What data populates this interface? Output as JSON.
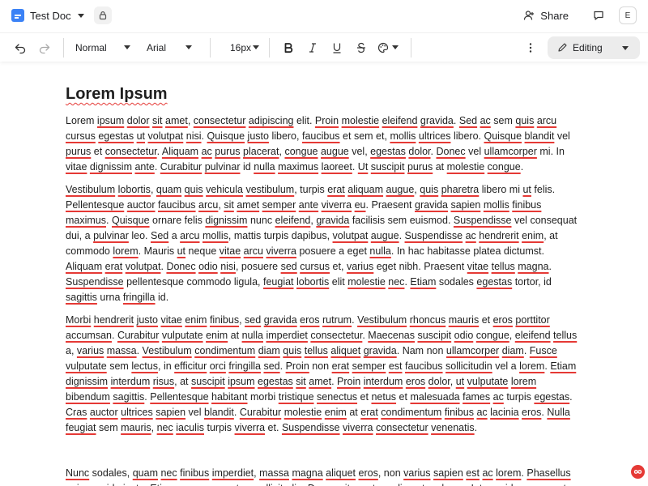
{
  "titlebar": {
    "doc_title": "Test Doc",
    "share_label": "Share",
    "avatar_initial": "E"
  },
  "toolbar": {
    "style_value": "Normal",
    "font_value": "Arial",
    "size_value": "16px",
    "mode_label": "Editing"
  },
  "document": {
    "heading": "Lorem Ipsum",
    "paragraphs": [
      "Lorem ipsum dolor sit amet, consectetur adipiscing elit. Proin molestie eleifend gravida. Sed ac sem quis arcu cursus egestas ut volutpat nisi. Quisque justo libero, faucibus et sem et, mollis ultrices libero. Quisque blandit vel purus et consectetur. Aliquam ac purus placerat, congue augue vel, egestas dolor. Donec vel ullamcorper mi. In vitae dignissim ante. Curabitur pulvinar id nulla maximus laoreet. Ut suscipit purus at molestie congue.",
      "Vestibulum lobortis, quam quis vehicula vestibulum, turpis erat aliquam augue, quis pharetra libero mi ut felis. Pellentesque auctor faucibus arcu, sit amet semper ante viverra eu. Praesent gravida sapien mollis finibus maximus. Quisque ornare felis dignissim nunc eleifend, gravida facilisis sem euismod. Suspendisse vel consequat dui, a pulvinar leo. Sed a arcu mollis, mattis turpis dapibus, volutpat augue. Suspendisse ac hendrerit enim, at commodo lorem. Mauris ut neque vitae arcu viverra posuere a eget nulla. In hac habitasse platea dictumst. Aliquam erat volutpat. Donec odio nisi, posuere sed cursus et, varius eget nibh. Praesent vitae tellus magna. Suspendisse pellentesque commodo ligula, feugiat lobortis elit molestie nec. Etiam sodales egestas tortor, id sagittis urna fringilla id.",
      "Morbi hendrerit justo vitae enim finibus, sed gravida eros rutrum. Vestibulum rhoncus mauris et eros porttitor accumsan. Curabitur vulputate enim at nulla imperdiet consectetur. Maecenas suscipit odio congue, eleifend tellus a, varius massa. Vestibulum condimentum diam quis tellus aliquet gravida. Nam non ullamcorper diam. Fusce vulputate sem lectus, in efficitur orci fringilla sed. Proin non erat semper est faucibus sollicitudin vel a lorem. Etiam dignissim interdum risus, at suscipit ipsum egestas sit amet. Proin interdum eros dolor, ut vulputate lorem bibendum sagittis. Pellentesque habitant morbi tristique senectus et netus et malesuada fames ac turpis egestas. Cras auctor ultrices sapien vel blandit. Curabitur molestie enim at erat condimentum finibus ac lacinia eros. Nulla feugiat sem mauris, nec iaculis turpis viverra et. Suspendisse viverra consectetur venenatis.",
      "Nunc sodales, quam nec finibus imperdiet, massa magna aliquet eros, non varius sapien est ac lorem. Phasellus quis gravida justo. Etiam cursus eu est ac sollicitudin. Donec sit amet condimentum lacus. Integer id cursus erat."
    ],
    "spellcheck_words": [
      "consectetur",
      "adipiscing",
      "Proin",
      "molestie",
      "eleifend",
      "gravida",
      "Sed",
      "quis",
      "arcu",
      "cursus",
      "egestas",
      "ut",
      "volutpat",
      "nisi",
      "Quisque",
      "justo",
      "faucibus",
      "mollis",
      "ultrices",
      "blandit",
      "purus",
      "Aliquam",
      "ac",
      "placerat",
      "congue",
      "augue",
      "dolor",
      "Donec",
      "ullamcorper",
      "vitae",
      "dignissim",
      "ante",
      "Curabitur",
      "pulvinar",
      "nulla",
      "maximus",
      "laoreet",
      "Ut",
      "suscipit",
      "Vestibulum",
      "lobortis",
      "quam",
      "vehicula",
      "vestibulum",
      "erat",
      "aliquam",
      "pharetra",
      "Pellentesque",
      "auctor",
      "amet",
      "semper",
      "viverra",
      "eu",
      "Morbi",
      "hendrerit",
      "enim",
      "finibus",
      "sed",
      "rutrum",
      "rhoncus",
      "mauris",
      "porttitor",
      "accumsan",
      "vulputate",
      "imperdiet",
      "Maecenas",
      "odio",
      "eleifend",
      "tellus",
      "varius",
      "massa",
      "condimentum",
      "diam",
      "aliquet",
      "Fusce",
      "lectus",
      "efficitur",
      "orci",
      "fringilla",
      "sollicitudin",
      "lorem",
      "Etiam",
      "interdum",
      "risus",
      "ipsum",
      "sit",
      "bibendum",
      "sagittis",
      "habitant",
      "tristique",
      "senectus",
      "netus",
      "malesuada",
      "fames",
      "Cras",
      "ultrices",
      "sapien",
      "lacinia",
      "Nulla",
      "feugiat",
      "nec",
      "iaculis",
      "Suspendisse",
      "venenatis",
      "Nunc",
      "magna",
      "Phasellus",
      "est",
      "eros"
    ]
  },
  "colors": {
    "accent_blue": "#3b82f6",
    "spellcheck_red": "#e53935",
    "editing_bg": "#ececec"
  },
  "icons": {
    "doc": "document-icon",
    "lock": "lock-icon",
    "share": "share-person-icon",
    "comment": "comment-icon",
    "undo": "undo-icon",
    "redo": "redo-icon",
    "italic": "italic-icon",
    "underline": "underline-icon",
    "strike": "strikethrough-icon",
    "palette": "palette-icon",
    "more": "more-vertical-icon",
    "pencil": "pencil-icon",
    "badge": "infinity-icon"
  }
}
